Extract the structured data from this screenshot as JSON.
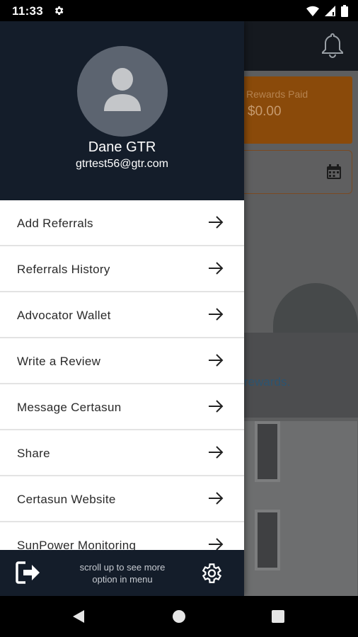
{
  "status_bar": {
    "time": "11:33"
  },
  "background": {
    "rewards_label": "Rewards Paid",
    "rewards_value": "$0.00",
    "link_text": "rewards."
  },
  "drawer": {
    "user_name": "Dane GTR",
    "user_email": "gtrtest56@gtr.com",
    "menu_items": [
      {
        "label": "Add Referrals"
      },
      {
        "label": "Referrals History"
      },
      {
        "label": "Advocator Wallet"
      },
      {
        "label": "Write a Review"
      },
      {
        "label": "Message Certasun"
      },
      {
        "label": "Share"
      },
      {
        "label": "Certasun Website"
      },
      {
        "label": "SunPower Monitoring"
      }
    ],
    "footer_hint_line1": "scroll up to see more",
    "footer_hint_line2": "option in menu"
  },
  "colors": {
    "drawer_header": "#141d2a",
    "accent_orange": "#8a4a0a"
  },
  "icons": [
    "settings-icon",
    "wifi-icon",
    "signal-icon",
    "battery-icon",
    "bell-icon",
    "calendar-icon",
    "user-avatar-icon",
    "arrow-right-icon",
    "logout-icon",
    "gear-icon"
  ]
}
